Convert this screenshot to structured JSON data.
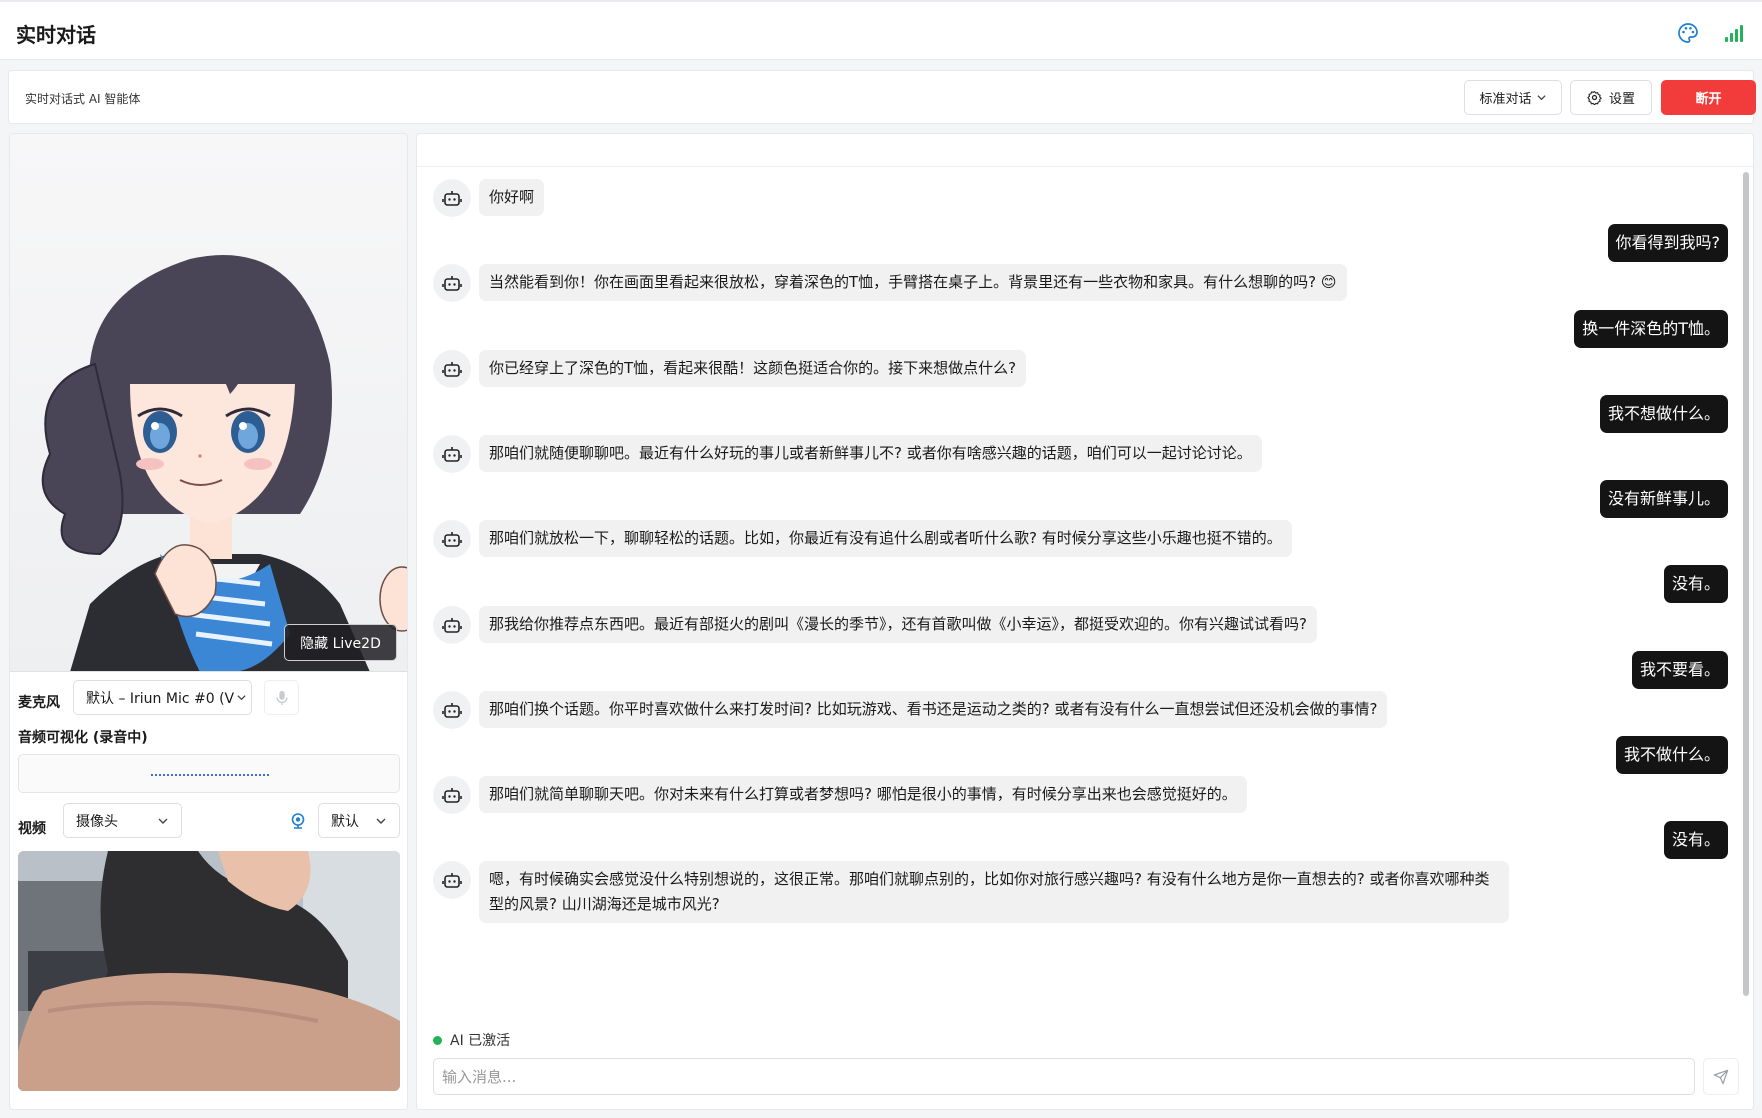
{
  "app": {
    "title": "实时对话"
  },
  "toolbar": {
    "subtitle": "实时对话式 AI 智能体",
    "mode_label": "标准对话",
    "settings_label": "设置",
    "disconnect_label": "断开",
    "disconnect_color": "#f23b3b"
  },
  "live2d": {
    "hide_button_label": "隐藏 Live2D"
  },
  "audio": {
    "mic_label": "麦克风",
    "mic_selected": "默认 – Iriun Mic #0 (V",
    "viz_label": "音频可视化 (录音中)"
  },
  "video": {
    "label": "视频",
    "source_selected": "摄像头",
    "quality_selected": "默认"
  },
  "chat": {
    "messages": [
      {
        "role": "ai",
        "text": "你好啊"
      },
      {
        "role": "user",
        "text": "你看得到我吗?"
      },
      {
        "role": "ai",
        "text": "当然能看到你！你在画面里看起来很放松，穿着深色的T恤，手臂搭在桌子上。背景里还有一些衣物和家具。有什么想聊的吗? 😊"
      },
      {
        "role": "user",
        "text": "换一件深色的T恤。"
      },
      {
        "role": "ai",
        "text": "你已经穿上了深色的T恤，看起来很酷！这颜色挺适合你的。接下来想做点什么?"
      },
      {
        "role": "user",
        "text": "我不想做什么。"
      },
      {
        "role": "ai",
        "text": "那咱们就随便聊聊吧。最近有什么好玩的事儿或者新鲜事儿不? 或者你有啥感兴趣的话题，咱们可以一起讨论讨论。"
      },
      {
        "role": "user",
        "text": "没有新鲜事儿。"
      },
      {
        "role": "ai",
        "text": "那咱们就放松一下，聊聊轻松的话题。比如，你最近有没有追什么剧或者听什么歌? 有时候分享这些小乐趣也挺不错的。"
      },
      {
        "role": "user",
        "text": "没有。"
      },
      {
        "role": "ai",
        "text": "那我给你推荐点东西吧。最近有部挺火的剧叫《漫长的季节》，还有首歌叫做《小幸运》，都挺受欢迎的。你有兴趣试试看吗?"
      },
      {
        "role": "user",
        "text": "我不要看。"
      },
      {
        "role": "ai",
        "text": "那咱们换个话题。你平时喜欢做什么来打发时间? 比如玩游戏、看书还是运动之类的? 或者有没有什么一直想尝试但还没机会做的事情?"
      },
      {
        "role": "user",
        "text": "我不做什么。"
      },
      {
        "role": "ai",
        "text": "那咱们就简单聊聊天吧。你对未来有什么打算或者梦想吗? 哪怕是很小的事情，有时候分享出来也会感觉挺好的。"
      },
      {
        "role": "user",
        "text": "没有。"
      },
      {
        "role": "ai",
        "text": "嗯，有时候确实会感觉没什么特别想说的，这很正常。那咱们就聊点别的，比如你对旅行感兴趣吗? 有没有什么地方是你一直想去的? 或者你喜欢哪种类型的风景? 山川湖海还是城市风光?"
      }
    ],
    "status": "AI 已激活",
    "status_color": "#22b359",
    "input_placeholder": "输入消息...",
    "input_value": ""
  }
}
